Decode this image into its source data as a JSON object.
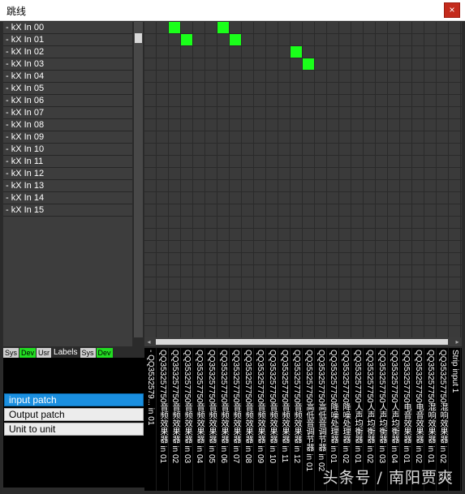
{
  "window": {
    "title": "跳线",
    "close_glyph": "×"
  },
  "rows": [
    "- kX In 00",
    "- kX In 01",
    "- kX In 02",
    "- kX In 03",
    "- kX In 04",
    "- kX In 05",
    "- kX In 06",
    "- kX In 07",
    "- kX In 08",
    "- kX In 09",
    "- kX In 10",
    "- kX In 11",
    "- kX In 12",
    "- kX In 13",
    "- kX In 14",
    "- kX In 15"
  ],
  "columns": [
    "- QQ3532579... in 01",
    "QQ353257750音频效果器 in 01",
    "QQ353257750音频效果器 in 02",
    "QQ353257750音频效果器 in 03",
    "QQ353257750音频效果器 in 04",
    "QQ353257750音频效果器 in 05",
    "QQ353257750音频效果器 in 06",
    "QQ353257750音频效果器 in 07",
    "QQ353257750音频效果器 in 08",
    "QQ353257750音频效果器 in 09",
    "QQ353257750音频效果器 in 10",
    "QQ353257750音频效果器 in 11",
    "QQ353257750音频效果器 in 12",
    "QQ353257750高低音调节器 in 01",
    "QQ353257750高低音调节器 in 02",
    "QQ353257750降噪处理器 in 01",
    "QQ353257750降噪处理器 in 02",
    "QQ353257750人声均衡器 in 01",
    "QQ353257750人声均衡器 in 02",
    "QQ353257750人声均衡器 in 03",
    "QQ353257750人声均衡器 in 04",
    "QQ353257750电音效果器 in 01",
    "QQ353257750电音效果器 in 02",
    "QQ353257750混响效果器 in 01",
    "QQ353257750混响效果器 in 02",
    "Strip input 1",
    "Strip input 2"
  ],
  "connections": [
    [
      0,
      2
    ],
    [
      0,
      6
    ],
    [
      1,
      3
    ],
    [
      1,
      7
    ],
    [
      2,
      12
    ],
    [
      3,
      13
    ]
  ],
  "filter_tabs": [
    {
      "label": "Sys",
      "active": false
    },
    {
      "label": "Dev",
      "active": true
    },
    {
      "label": "Usr",
      "active": false
    },
    {
      "label": "Labels",
      "plain": true
    },
    {
      "label": "Sys",
      "active": false
    },
    {
      "label": "Dev",
      "active": true
    }
  ],
  "modes": [
    {
      "label": "input patch",
      "active": true
    },
    {
      "label": "Output patch",
      "active": false
    },
    {
      "label": "Unit to unit",
      "active": false
    }
  ],
  "watermark": "头条号 / 南阳贾爽",
  "colors": {
    "connected": "#1aff1a",
    "active_mode": "#1a8fe0",
    "close": "#c42b1c"
  }
}
